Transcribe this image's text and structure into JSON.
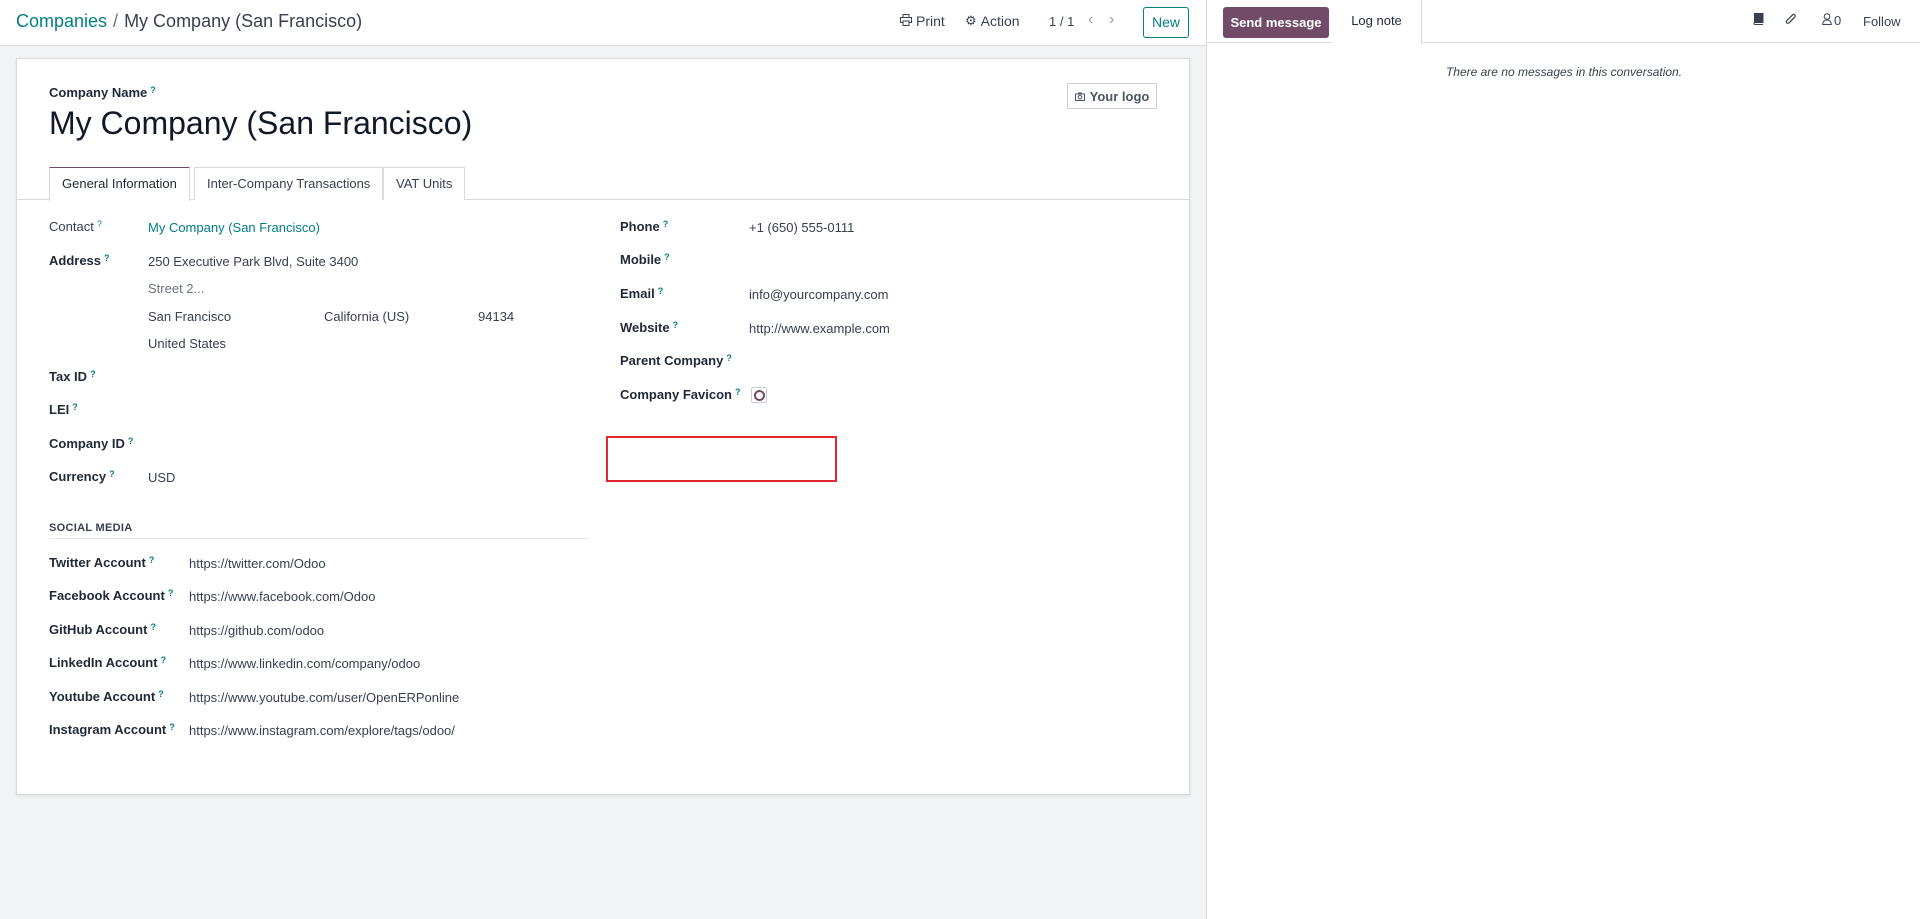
{
  "breadcrumb": {
    "parent": "Companies",
    "separator": "/",
    "current": "My Company (San Francisco)"
  },
  "control_panel": {
    "print": "Print",
    "action": "Action",
    "pager": "1 / 1",
    "new": "New"
  },
  "form": {
    "company_name_label": "Company Name",
    "company_name": "My Company (San Francisco)",
    "logo_button": "Your logo",
    "help": "?",
    "tabs": [
      "General Information",
      "Inter-Company Transactions",
      "VAT Units"
    ],
    "left": {
      "contact_label": "Contact",
      "contact_value": "My Company (San Francisco)",
      "address_label": "Address",
      "street": "250 Executive Park Blvd, Suite 3400",
      "street2_placeholder": "Street 2...",
      "city": "San Francisco",
      "state": "California (US)",
      "zip": "94134",
      "country": "United States",
      "tax_id_label": "Tax ID",
      "lei_label": "LEI",
      "company_id_label": "Company ID",
      "currency_label": "Currency",
      "currency_value": "USD"
    },
    "right": {
      "phone_label": "Phone",
      "phone_value": "+1 (650) 555-0111",
      "mobile_label": "Mobile",
      "email_label": "Email",
      "email_value": "info@yourcompany.com",
      "website_label": "Website",
      "website_value": "http://www.example.com",
      "parent_company_label": "Parent Company",
      "company_favicon_label": "Company Favicon"
    },
    "social": {
      "title": "SOCIAL MEDIA",
      "twitter_label": "Twitter Account",
      "twitter_value": "https://twitter.com/Odoo",
      "facebook_label": "Facebook Account",
      "facebook_value": "https://www.facebook.com/Odoo",
      "github_label": "GitHub Account",
      "github_value": "https://github.com/odoo",
      "linkedin_label": "LinkedIn Account",
      "linkedin_value": "https://www.linkedin.com/company/odoo",
      "youtube_label": "Youtube Account",
      "youtube_value": "https://www.youtube.com/user/OpenERPonline",
      "instagram_label": "Instagram Account",
      "instagram_value": "https://www.instagram.com/explore/tags/odoo/"
    }
  },
  "chatter": {
    "send_message": "Send message",
    "log_note": "Log note",
    "followers_count": "0",
    "follow": "Follow",
    "empty": "There are no messages in this conversation."
  },
  "colors": {
    "accent": "#017e84",
    "brand": "#714b67",
    "highlight": "#e0282e"
  },
  "icons": [
    "print-icon",
    "gear-icon",
    "chevron-left-icon",
    "chevron-right-icon",
    "camera-icon",
    "book-icon",
    "paperclip-icon",
    "user-icon"
  ]
}
